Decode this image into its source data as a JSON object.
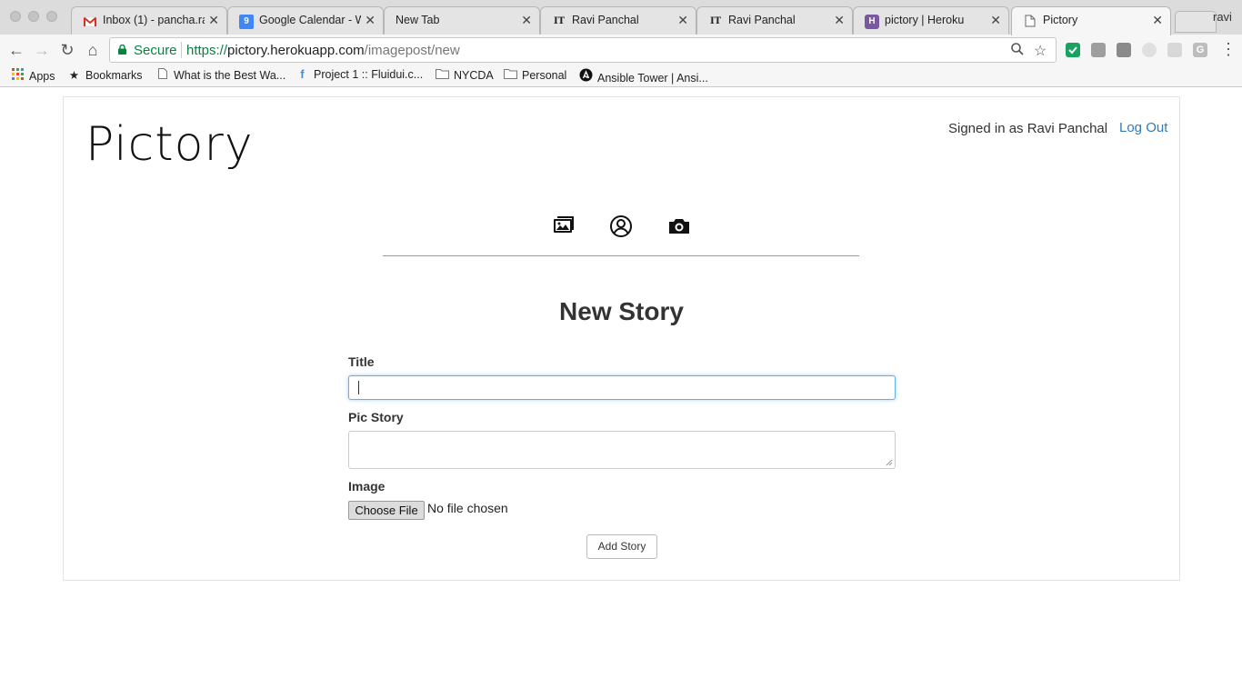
{
  "browser": {
    "tabs": [
      {
        "title": "Inbox (1) - pancha.ra",
        "icon": "gmail-icon",
        "accent": "#d93025"
      },
      {
        "title": "Google Calendar - W",
        "icon": "calendar-icon",
        "accent": "#4285f4"
      },
      {
        "title": "New Tab",
        "icon": "",
        "accent": ""
      },
      {
        "title": "Ravi Panchal",
        "icon": "it-icon",
        "accent": "#333333"
      },
      {
        "title": "Ravi Panchal",
        "icon": "it-icon",
        "accent": "#333333"
      },
      {
        "title": "pictory | Heroku",
        "icon": "heroku-icon",
        "accent": "#79589f"
      },
      {
        "title": "Pictory",
        "icon": "page-icon",
        "accent": "#666666"
      }
    ],
    "profile_name": "ravi",
    "security_label": "Secure",
    "url": {
      "scheme": "https://",
      "host": "pictory.herokuapp.com",
      "path": "/imagepost/new"
    },
    "bookmarks": [
      {
        "label": "Apps",
        "icon": "apps-grid-icon"
      },
      {
        "label": "Bookmarks",
        "icon": "star-icon"
      },
      {
        "label": "What is the Best Wa...",
        "icon": "page-icon"
      },
      {
        "label": "Project 1 :: Fluidui.c...",
        "icon": "fluid-icon"
      },
      {
        "label": "NYCDA",
        "icon": "folder-icon"
      },
      {
        "label": "Personal",
        "icon": "folder-icon"
      },
      {
        "label": "Ansible Tower | Ansi...",
        "icon": "ansible-icon"
      }
    ]
  },
  "site": {
    "logo": "Pictory",
    "signed_in_text": "Signed in as Ravi Panchal",
    "logout_label": "Log Out",
    "nav": [
      "gallery-icon",
      "profile-icon",
      "camera-icon"
    ]
  },
  "form": {
    "heading": "New Story",
    "title_label": "Title",
    "title_value": "",
    "story_label": "Pic Story",
    "story_value": "",
    "image_label": "Image",
    "choose_file_label": "Choose File",
    "no_file_text": "No file chosen",
    "submit_label": "Add Story"
  },
  "colors": {
    "link": "#337ab7",
    "secure": "#0b8043",
    "focus": "#66afe9"
  }
}
